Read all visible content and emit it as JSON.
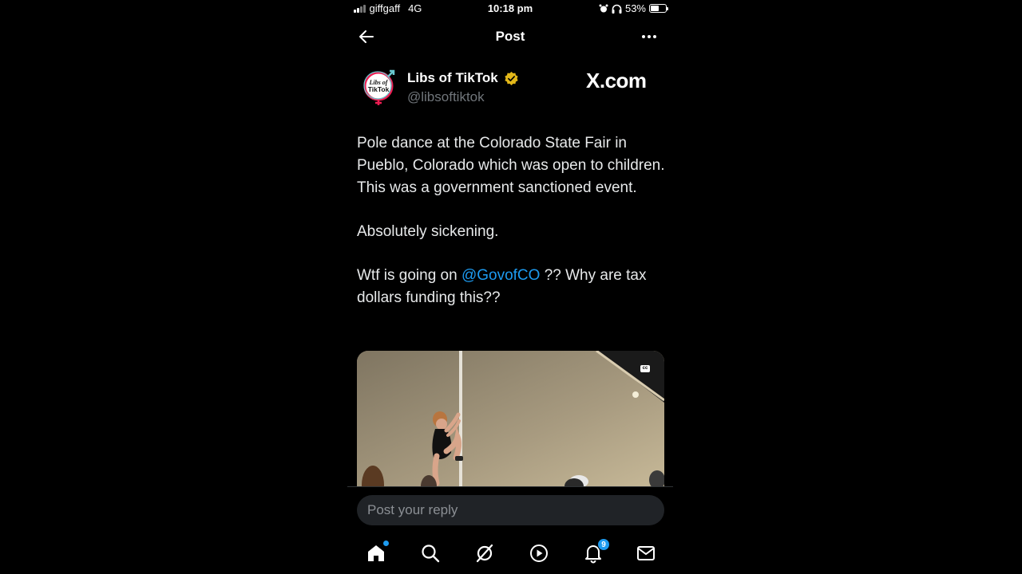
{
  "status_bar": {
    "carrier": "giffgaff",
    "network": "4G",
    "time": "10:18 pm",
    "battery": "53%",
    "battery_level": 0.53
  },
  "header": {
    "title": "Post"
  },
  "post": {
    "author_name": "Libs of TikTok",
    "author_handle": "@libsoftiktok",
    "avatar_text_line1": "Libs of",
    "avatar_text_line2": "TikTok",
    "watermark": "X.com",
    "text_p1": "Pole dance at the Colorado State Fair in Pueblo, Colorado which was open to children. This was a government sanctioned event.",
    "text_p2": "Absolutely sickening.",
    "text_p3_before": "Wtf is going on ",
    "text_p3_mention": "@GovofCO",
    "text_p3_after": " ?? Why are tax dollars funding this??",
    "media_cc": "cc"
  },
  "reply": {
    "placeholder": "Post your reply"
  },
  "nav": {
    "notifications_count": "9"
  },
  "colors": {
    "background": "#000000",
    "text": "#e7e9ea",
    "secondary_text": "#71767b",
    "accent": "#1d9bf0",
    "verified_gold": "#e2b719"
  }
}
